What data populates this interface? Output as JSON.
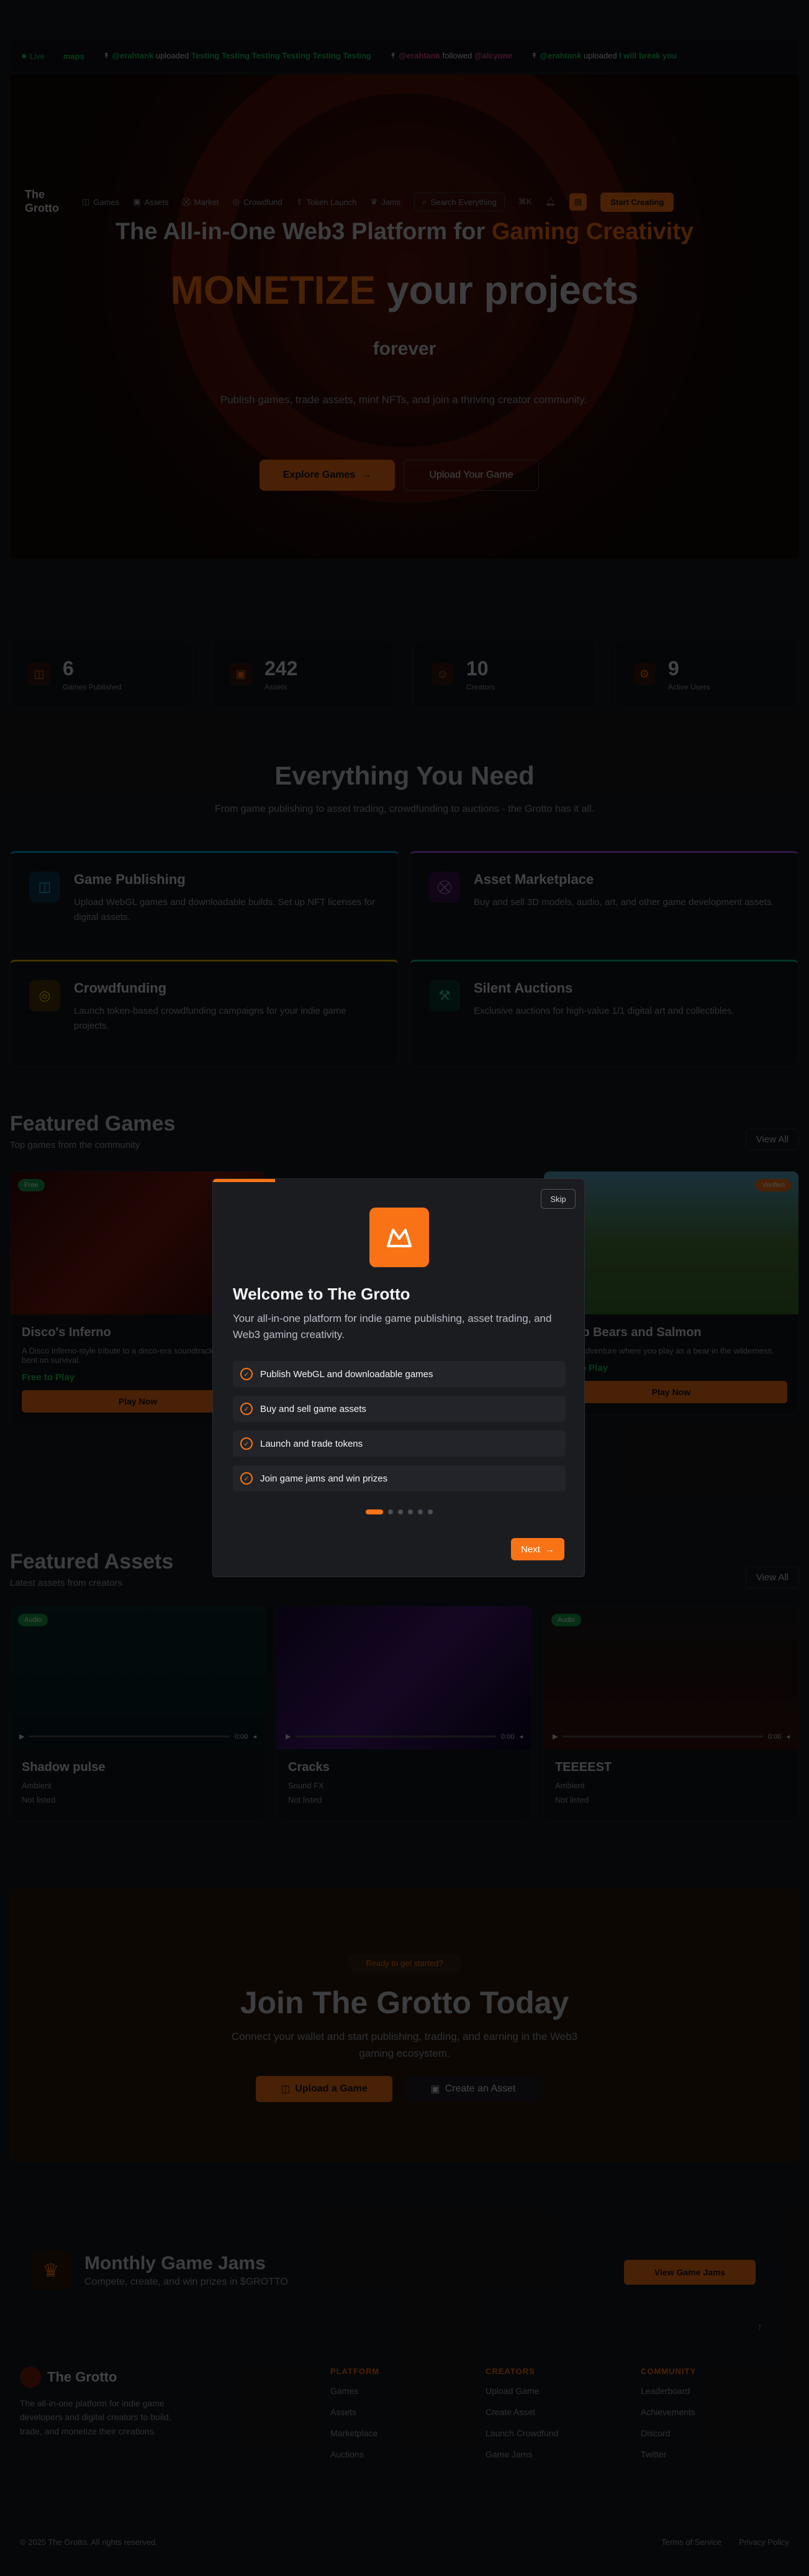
{
  "ticker": {
    "live": "Live",
    "items": [
      {
        "prefix": "",
        "user": "maps",
        "verb": "",
        "title": ""
      },
      {
        "prefix": "",
        "user": "@erahtank",
        "verb": "uploaded",
        "title": "Testing Testing Testing Testing Testing Testing"
      },
      {
        "prefix": "",
        "user": "@erahtank",
        "verb": "followed",
        "title": "@alcyone"
      },
      {
        "prefix": "",
        "user": "@erahtank",
        "verb": "uploaded",
        "title": "I will break you"
      }
    ]
  },
  "nav": {
    "brand": "The Grotto",
    "items": [
      "Games",
      "Assets",
      "Market",
      "Crowdfund",
      "Token Launch",
      "Jams",
      "Search Everything",
      "⌘K"
    ],
    "cta": "Start Creating"
  },
  "hero": {
    "title_pre": "The All-in-One Web3 Platform for ",
    "title_acc": "Gaming Creativity",
    "big_acc": "MONETIZE",
    "big_rest": " your projects",
    "sub": "forever",
    "desc": "Publish games, trade assets, mint NFTs, and join a thriving creator community.",
    "btn_primary": "Explore Games",
    "btn_secondary": "Upload Your Game"
  },
  "stats": [
    {
      "num": "6",
      "label": "Games Published"
    },
    {
      "num": "242",
      "label": "Assets"
    },
    {
      "num": "10",
      "label": "Creators"
    },
    {
      "num": "9",
      "label": "Active Users"
    }
  ],
  "everything": {
    "title": "Everything You Need",
    "desc": "From game publishing to asset trading, crowdfunding to auctions - the Grotto has it all."
  },
  "features": [
    {
      "title": "Game Publishing",
      "desc": "Upload WebGL games and downloadable builds. Set up NFT licenses for digital assets."
    },
    {
      "title": "Asset Marketplace",
      "desc": "Buy and sell 3D models, audio, art, and other game development assets."
    },
    {
      "title": "Crowdfunding",
      "desc": "Launch token-based crowdfunding campaigns for your indie game projects."
    },
    {
      "title": "Silent Auctions",
      "desc": "Exclusive auctions for high-value 1/1 digital art and collectibles."
    }
  ],
  "featured_games": {
    "title": "Featured Games",
    "sub": "Top games from the community",
    "view_all": "View All",
    "cards": [
      {
        "tag": "Free",
        "title": "Disco's Inferno",
        "meta": "A Disco Inferno-style tribute to a disco-era soundtrack and hell bent on survival.",
        "price": "Free to Play",
        "btn": "Play Now"
      },
      {
        "tag": "Verified",
        "title": "Camp Bears and Salmon",
        "meta": "A cozy adventure where you play as a bear in the wilderness.",
        "price": "Free to Play",
        "btn": "Play Now"
      }
    ]
  },
  "featured_assets": {
    "title": "Featured Assets",
    "sub": "Latest assets from creators",
    "view_all": "View All",
    "cards": [
      {
        "tag": "Audio",
        "title": "Shadow pulse",
        "meta": "Ambient",
        "price": "Not listed",
        "time": "0:00"
      },
      {
        "tag": "Audio",
        "title": "Cracks",
        "meta": "Sound FX",
        "price": "Not listed",
        "time": "0:00"
      },
      {
        "tag": "Audio",
        "title": "TEEEEST",
        "meta": "Ambient",
        "price": "Not listed",
        "time": "0:00"
      }
    ]
  },
  "cta": {
    "pill": "Ready to get started?",
    "title": "Join The Grotto Today",
    "desc": "Connect your wallet and start publishing, trading, and earning in the Web3 gaming ecosystem.",
    "btn1": "Upload a Game",
    "btn2": "Create an Asset"
  },
  "jam": {
    "title": "Monthly Game Jams",
    "desc": "Compete, create, and win prizes in $GROTTO",
    "btn": "View Game Jams"
  },
  "footer": {
    "brand": "The Grotto",
    "desc": "The all-in-one platform for indie game developers and digital creators to build, trade, and monetize their creations.",
    "cols": [
      {
        "title": "PLATFORM",
        "links": [
          "Games",
          "Assets",
          "Marketplace",
          "Auctions"
        ]
      },
      {
        "title": "CREATORS",
        "links": [
          "Upload Game",
          "Create Asset",
          "Launch Crowdfund",
          "Game Jams"
        ]
      },
      {
        "title": "COMMUNITY",
        "links": [
          "Leaderboard",
          "Achievements",
          "Discord",
          "Twitter"
        ]
      }
    ],
    "copyright": "© 2025 The Grotto. All rights reserved.",
    "terms": "Terms of Service",
    "privacy": "Privacy Policy"
  },
  "modal": {
    "skip": "Skip",
    "title": "Welcome to The Grotto",
    "desc": "Your all-in-one platform for indie game publishing, asset trading, and Web3 gaming creativity.",
    "items": [
      "Publish WebGL and downloadable games",
      "Buy and sell game assets",
      "Launch and trade tokens",
      "Join game jams and win prizes"
    ],
    "next": "Next",
    "step_count": 6,
    "active_step": 1
  }
}
